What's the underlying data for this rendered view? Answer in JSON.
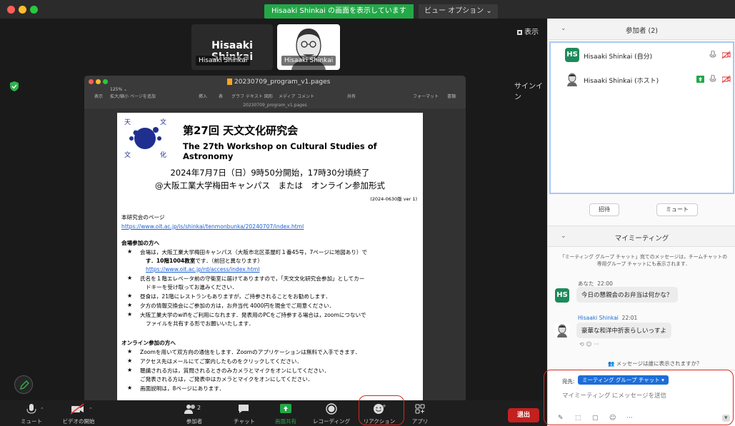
{
  "banner": {
    "sharing": "Hisaaki Shinkai の画面を表示しています",
    "view_options": "ビュー オプション ⌄"
  },
  "colors": {
    "accent": "#1c6ed8",
    "share_green": "#23a848",
    "end_red": "#c2211f",
    "avatar_green": "#1e8a5a"
  },
  "meeting": {
    "tile1": {
      "big_name": "Hisaaki Shinkai",
      "tag": "Hisaaki Shinkai"
    },
    "tile2": {
      "tag": "Hisaaki Shinkai"
    },
    "view_label": "表示",
    "signin_label": "サインイン"
  },
  "doc": {
    "window_title": "20230709_program_v1.pages",
    "sub_title": "20230709_program_v1.pages",
    "zoom": "125% ⌄",
    "tools": [
      "表示",
      "拡大/縮小",
      "ページを追加",
      "挿入",
      "表",
      "グラフ",
      "テキスト",
      "図形",
      "メディア",
      "コメント",
      "共有",
      "フォーマット",
      "書類"
    ],
    "logo_chars": [
      "天",
      "文",
      "文",
      "化"
    ],
    "title_jp": "第27回 天文文化研究会",
    "title_en": "The 27th Workshop on Cultural Studies of Astronomy",
    "date": "2024年7月7日（日）9時50分開始，17時30分頃終了",
    "place": "@大阪工業大学梅田キャンパス　または　オンライン参加形式",
    "version": "(2024-0630版 ver 1)",
    "homepage_label": "本研究会のページ",
    "homepage_url": "https://www.oit.ac.jp/is/shinkai/tenmonbunka/20240707/index.html",
    "onsite_heading": "会場参加の方へ",
    "onsite_1a": "会場は，大阪工業大学梅田キャンパス（大阪市北区茶屋町１番45号，7ページに地図あり）で",
    "onsite_1b_bold": "す．10階1004教室",
    "onsite_1b_rest": "です．（前回と異なります）",
    "onsite_1_url": "https://www.oit.ac.jp/rd/access/index.html",
    "onsite_2a": "氏名を１階エレベータ前の守衛室に届けてありますので，「天文文化研究会参加」としてカー",
    "onsite_2b": "ドキーを受け取ってお進みください．",
    "onsite_3": "昼食は，21階にレストランもありますが，ご持参されることをお勧めします．",
    "onsite_4": "夕方の情報交換会にご参加の方は，お弁当代 4000円を現金でご用意ください．",
    "onsite_5a": "大阪工業大学のwifiをご利用になれます．発表用のPCをご持参する場合は，zoomにつないで",
    "onsite_5b": "ファイルを共有する形でお願いいたします．",
    "online_heading": "オンライン参加の方へ",
    "online_1": "Zoomを用いて双方向の通信をします．Zoomのアプリケーションは無料で入手できます．",
    "online_2": "アクセス先はメールにてご案内したものをクリックしてください．",
    "online_3a": "聴講される方は，質問されるときのみカメラとマイクをオンにしてください．",
    "online_3b": "ご発表される方は，ご発表中はカメラとマイクをオンにしてください．",
    "online_4": "画面説明は，8ページにあります．"
  },
  "toolbar": {
    "mute": "ミュート",
    "video": "ビデオの開始",
    "participants": "参加者",
    "participants_count": "2",
    "chat": "チャット",
    "share": "画面共有",
    "record": "レコーディング",
    "reactions": "リアクション",
    "apps": "アプリ",
    "end": "退出"
  },
  "panel": {
    "participants_title": "参加者 (2)",
    "participants": [
      {
        "initials": "HS",
        "name": "Hisaaki Shinkai (自分)"
      },
      {
        "initials": "",
        "name": "Hisaaki Shinkai (ホスト)"
      }
    ],
    "invite": "招待",
    "mute_all": "ミュート",
    "chat_title": "マイミーティング",
    "chat_notice": "「ミーティング グループ チャット」宛てのメッセージは，チームチャットの専用グループ チャットにも表示されます．",
    "messages": [
      {
        "sender": "あなた",
        "time": "22:00",
        "text": "今日の懇親会のお弁当は何かな？"
      },
      {
        "sender": "Hisaaki Shinkai",
        "time": "22:01",
        "text": "豪華な和洋中折衷らしいっすよ"
      }
    ],
    "who_sees": "メッセージは誰に表示されますか？",
    "to_label": "宛先:",
    "to_value": "ミーティング グループ チャット ▾",
    "input_placeholder": "マイミーティング にメッセージを送信"
  }
}
